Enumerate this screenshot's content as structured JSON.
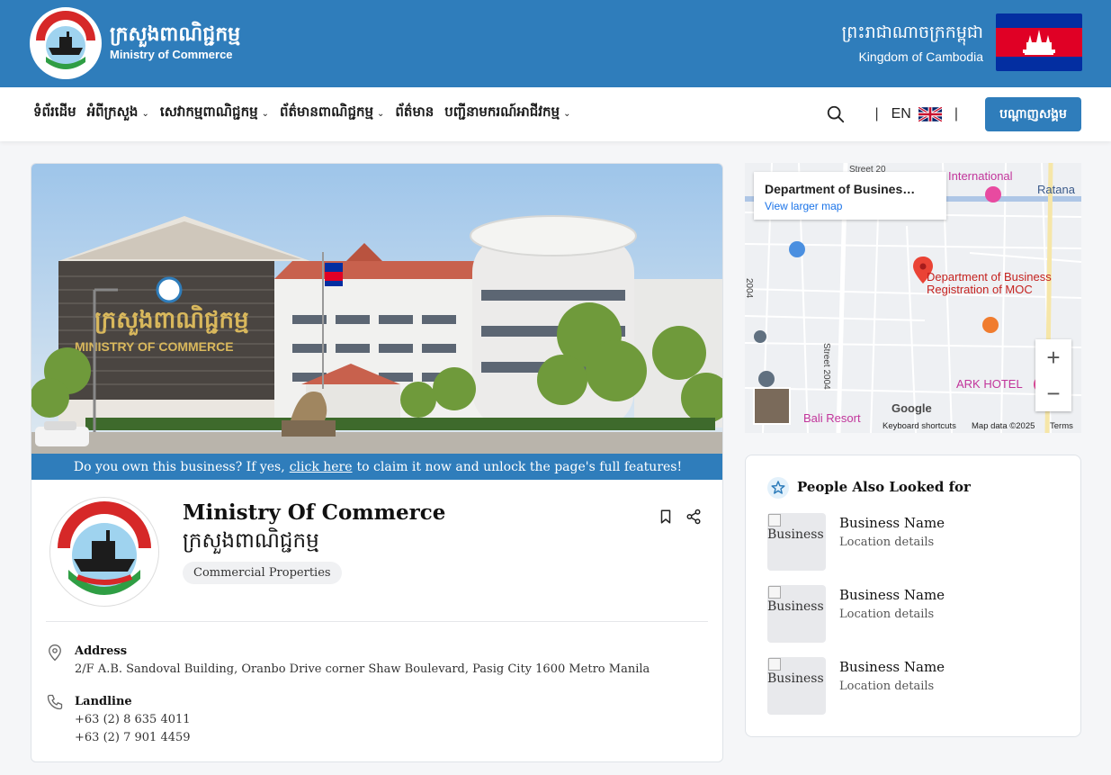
{
  "header": {
    "title_km": "ក្រសួងពាណិជ្ជកម្ម",
    "title_en": "Ministry of Commerce",
    "kingdom_km": "ព្រះរាជាណាចក្រកម្ពុជា",
    "kingdom_en": "Kingdom of Cambodia"
  },
  "nav": {
    "items": [
      {
        "label": "ទំព័រដើម"
      },
      {
        "label": "អំពីក្រសួង"
      },
      {
        "label": "សេវាកម្មពាណិជ្ជកម្ម"
      },
      {
        "label": "ព័ត៌មានពាណិជ្ជកម្ម"
      },
      {
        "label": "ព័ត៌មាន"
      },
      {
        "label": "បញ្ជីនាមករណ៍អាជីវកម្ម"
      }
    ],
    "lang": "EN",
    "signup_label": "បណ្តាញសង្គម"
  },
  "claim": {
    "prefix": "Do you own this business? If yes,",
    "link": "click here",
    "suffix": "to claim it now and unlock the page's full features!"
  },
  "hero": {
    "building_sign_km": "ក្រសួងពាណិជ្ជកម្ម",
    "building_sign_en": "MINISTRY OF COMMERCE"
  },
  "business": {
    "name": "Ministry Of Commerce",
    "name_km": "ក្រសួងពាណិជ្ជកម្ម",
    "category": "Commercial Properties",
    "address_label": "Address",
    "address": "2/F A.B. Sandoval Building, Oranbo Drive corner Shaw Boulevard, Pasig City 1600 Metro Manila",
    "landline_label": "Landline",
    "phones": [
      "+63 (2) 8 635 4011",
      "+63 (2) 7 901 4459"
    ]
  },
  "map": {
    "card_title": "Department of Busines…",
    "card_link": "View larger map",
    "pin_label_1": "Department of Business",
    "pin_label_2": "Registration of MOC",
    "label_international": "International",
    "label_ratana": "Ratana",
    "label_street2004": "Street 2004",
    "label_ark": "ARK HOTEL",
    "label_bali": "Bali Resort",
    "label_street_top": "Street 20",
    "label_2004_left": "2004",
    "google": "Google",
    "keyboard": "Keyboard shortcuts",
    "mapdata": "Map data ©2025",
    "terms": "Terms"
  },
  "related": {
    "title": "People Also Looked for",
    "items": [
      {
        "thumb_alt": "Business",
        "name": "Business Name",
        "location": "Location details"
      },
      {
        "thumb_alt": "Business",
        "name": "Business Name",
        "location": "Location details"
      },
      {
        "thumb_alt": "Business",
        "name": "Business Name",
        "location": "Location details"
      }
    ]
  },
  "colors": {
    "brand_blue": "#2f7dbb",
    "flag_blue": "#032ea1",
    "flag_red": "#e00025",
    "map_pin": "#ea4335"
  }
}
